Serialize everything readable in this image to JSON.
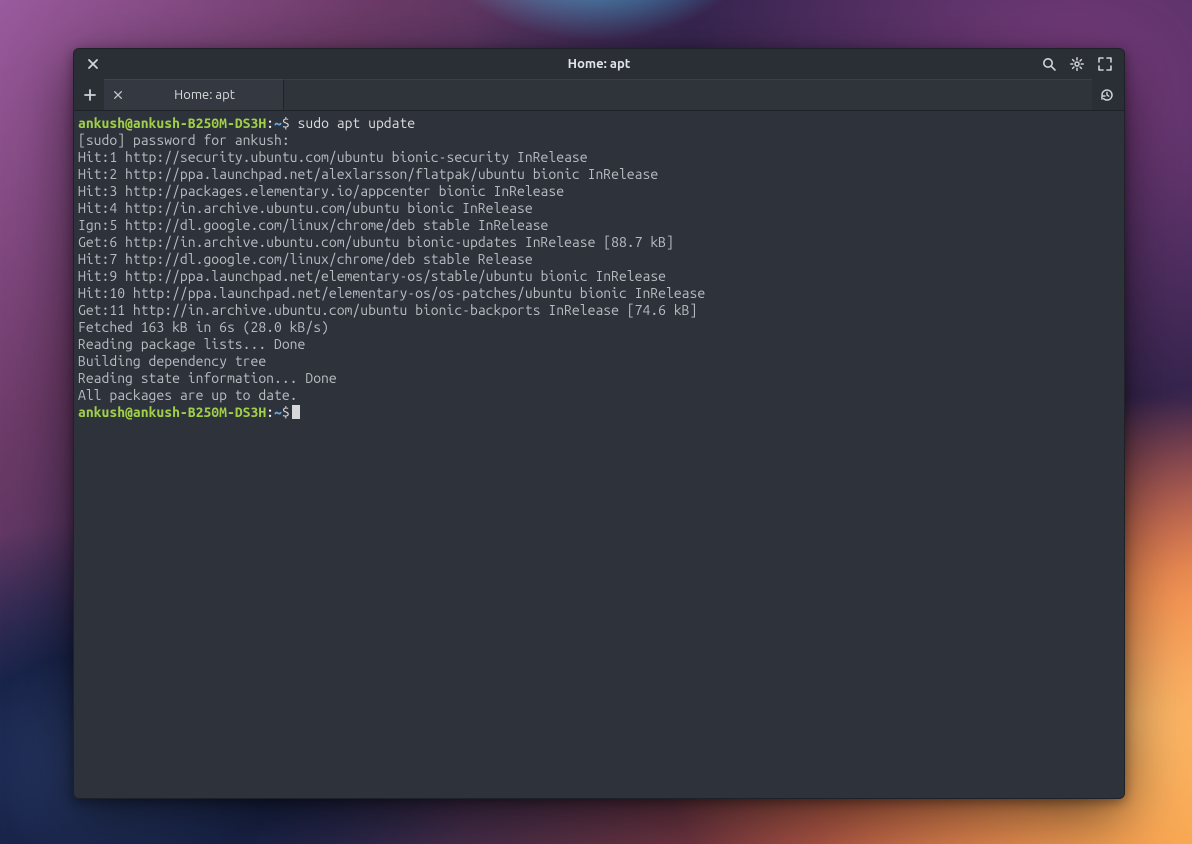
{
  "window": {
    "title": "Home: apt"
  },
  "tab": {
    "label": "Home: apt"
  },
  "prompt1": {
    "user_host": "ankush@ankush-B250M-DS3H",
    "path": "~",
    "command": "sudo apt update"
  },
  "output_lines": [
    "[sudo] password for ankush:",
    "Hit:1 http://security.ubuntu.com/ubuntu bionic-security InRelease",
    "Hit:2 http://ppa.launchpad.net/alexlarsson/flatpak/ubuntu bionic InRelease",
    "Hit:3 http://packages.elementary.io/appcenter bionic InRelease",
    "Hit:4 http://in.archive.ubuntu.com/ubuntu bionic InRelease",
    "Ign:5 http://dl.google.com/linux/chrome/deb stable InRelease",
    "Get:6 http://in.archive.ubuntu.com/ubuntu bionic-updates InRelease [88.7 kB]",
    "Hit:7 http://dl.google.com/linux/chrome/deb stable Release",
    "Hit:9 http://ppa.launchpad.net/elementary-os/stable/ubuntu bionic InRelease",
    "Hit:10 http://ppa.launchpad.net/elementary-os/os-patches/ubuntu bionic InRelease",
    "Get:11 http://in.archive.ubuntu.com/ubuntu bionic-backports InRelease [74.6 kB]",
    "Fetched 163 kB in 6s (28.0 kB/s)",
    "Reading package lists... Done",
    "Building dependency tree",
    "Reading state information... Done",
    "All packages are up to date."
  ],
  "prompt2": {
    "user_host": "ankush@ankush-B250M-DS3H",
    "path": "~"
  }
}
